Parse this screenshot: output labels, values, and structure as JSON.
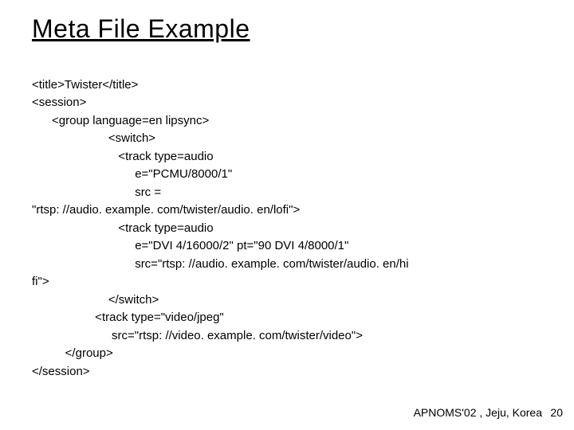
{
  "title": "Meta File Example",
  "code": {
    "l1": "<title>Twister</title>",
    "l2": "<session>",
    "l3": "      <group language=en lipsync>",
    "l4": "                       <switch>",
    "l5": "                          <track type=audio",
    "l6": "                               e=\"PCMU/8000/1\"",
    "l7": "                               src =",
    "l8": "\"rtsp: //audio. example. com/twister/audio. en/lofi\">",
    "l9": "                          <track type=audio",
    "l10": "                               e=\"DVI 4/16000/2\" pt=\"90 DVI 4/8000/1\"",
    "l11": "                               src=\"rtsp: //audio. example. com/twister/audio. en/hi",
    "l12": "fi\">",
    "l13": "                       </switch>",
    "l14": "                   <track type=\"video/jpeg\"",
    "l15": "                        src=\"rtsp: //video. example. com/twister/video\">",
    "l16": "          </group>",
    "l17": "</session>"
  },
  "footer": "APNOMS'02 , Jeju, Korea",
  "page": "20"
}
